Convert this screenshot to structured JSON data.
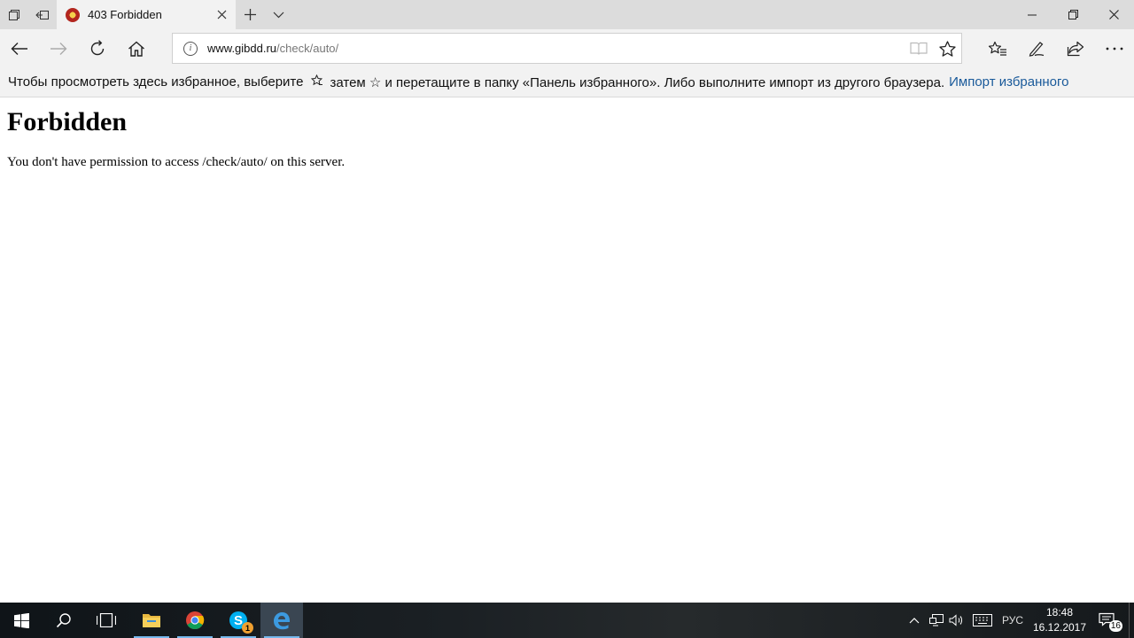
{
  "browser": {
    "tab": {
      "title": "403 Forbidden"
    },
    "address": {
      "host": "www.gibdd.ru",
      "path": "/check/auto/"
    },
    "favorites_hint": {
      "part1": "Чтобы просмотреть здесь избранное, выберите",
      "star1": "☆̄",
      "part2": "затем ☆ и перетащите в папку «Панель избранного». Либо выполните импорт из другого браузера.",
      "link": "Импорт избранного"
    }
  },
  "page": {
    "heading": "Forbidden",
    "message": "You don't have permission to access /check/auto/ on this server."
  },
  "taskbar": {
    "tray": {
      "language": "РУС",
      "notifications_count": "16",
      "skype_badge": "1"
    },
    "clock": {
      "time": "18:48",
      "date": "16.12.2017"
    }
  }
}
